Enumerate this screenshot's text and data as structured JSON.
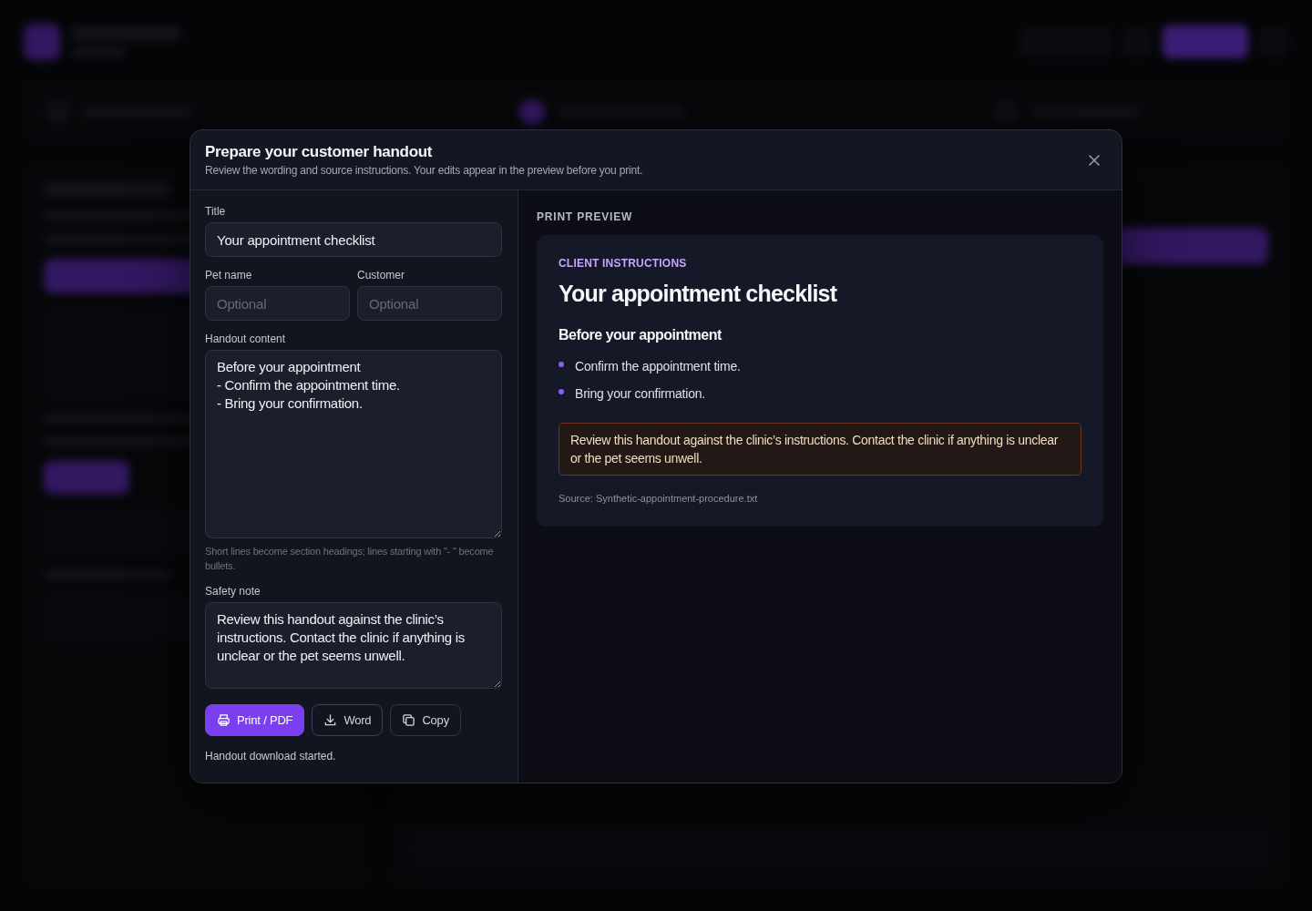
{
  "modal": {
    "title": "Prepare your customer handout",
    "subtitle": "Review the wording and source instructions. Your edits appear in the preview before you print."
  },
  "form": {
    "rows": [
      [
        {
          "kind": "input",
          "label": "Title",
          "value": "Your appointment checklist"
        }
      ],
      [
        {
          "kind": "input",
          "label": "Pet name",
          "placeholder": "Optional"
        },
        {
          "kind": "input",
          "label": "Customer",
          "placeholder": "Optional"
        }
      ],
      [
        {
          "kind": "textarea",
          "label": "Handout content",
          "value": "Before your appointment\n- Confirm the appointment time.\n- Bring your confirmation.",
          "hint": "Short lines become section headings; lines starting with \"- \" become bullets."
        }
      ],
      [
        {
          "kind": "note",
          "label": "Safety note",
          "value": "Review this handout against the clinic’s instructions. Contact the clinic if anything is unclear or the pet seems unwell."
        }
      ]
    ],
    "buttons": [
      {
        "kind": "print",
        "label": "Print / PDF"
      },
      {
        "kind": "download",
        "label": "Word"
      },
      {
        "kind": "copy",
        "label": "Copy"
      }
    ],
    "status": "Handout download started."
  },
  "preview": {
    "heading": "PRINT PREVIEW",
    "eyebrow": "CLIENT INSTRUCTIONS",
    "title": "Your appointment checklist",
    "sections": [
      {
        "heading": "Before your appointment",
        "bullets": [
          "Confirm the appointment time.",
          "Bring your confirmation."
        ]
      }
    ],
    "safety_note": "Review this handout against the clinic’s instructions. Contact the clinic if anything is unclear or the pet seems unwell.",
    "source": "Source: Synthetic-appointment-procedure.txt"
  }
}
